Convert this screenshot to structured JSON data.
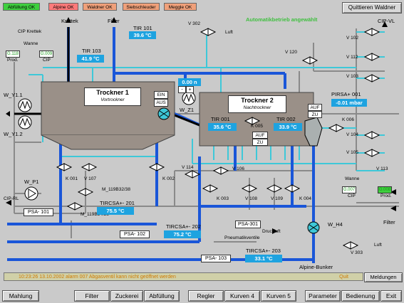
{
  "status_badges": {
    "abfuellung_ok": "Abfüllung OK",
    "alpine_ok": "Alpine OK",
    "waldner_ok": "Waldner OK",
    "siebschleuder": "Siebschleuder",
    "meggle_ok": "Meggle OK"
  },
  "quit_button": "Quittieren Waldner",
  "auto_mode": "Automatikbetrieb angewählt",
  "labels": {
    "krettek": "Krettek",
    "filter_top": "Filter",
    "cip_krettek": "CIP Krettek",
    "wanne_left": "Wanne",
    "g118": "G.118",
    "g009": "G.009",
    "prod_left": "Prod.",
    "cip_left": "CIP",
    "tir101": "TIR 101",
    "tir103": "TIR 103",
    "v302": "V 302",
    "luft_top": "Luft",
    "cip_vl": "CIP-VL",
    "v102": "V 102",
    "v112": "V 112",
    "v103": "V 103",
    "v120": "V 120",
    "wy11": "W_Y1.1",
    "wy12": "W_Y1.2",
    "wz1": "W_Z1",
    "pirsa001": "PIRSA+ 001",
    "k006": "K 006",
    "v104": "V 104",
    "v105": "V 105",
    "v113": "V 113",
    "k001": "K 001",
    "v107": "V 107",
    "k002": "K 002",
    "m119b32": "M_119B32/38",
    "m119b24": "M_119B24/28",
    "v114": "V 114",
    "v106": "V 106",
    "k003": "K 003",
    "v108": "V 108",
    "v109": "V 109",
    "k004": "K 004",
    "wp1": "W_P1",
    "cip_rl": "CIP-RL",
    "psa101": "PSA- 101",
    "psa102": "PSA- 102",
    "psa103": "PSA- 103",
    "psa301": "PSA-301",
    "druckluft": "Druckluft",
    "pneumatikventile": "Pneumatikventile",
    "tircsa201": "TIRCSA+- 201",
    "tircsa202": "TIRCSA+- 202",
    "tircsa203": "TIRCSA+- 203",
    "wanne_right": "Wanne",
    "g007": "G.007",
    "g008": "G.008",
    "cip_right": "CIP",
    "prod_right": "Prod.",
    "filter_right": "Filter",
    "wh4": "W_H4",
    "luft_right": "Luft",
    "v303": "V 303",
    "alpine_bunker": "Alpine-Bunker",
    "k005": "K 005",
    "tir001": "TIR  001",
    "tir002": "TIR  002"
  },
  "values": {
    "tir101": "39.6  °C",
    "tir103": "41.9  °C",
    "zero_n": "0.00   n",
    "tir001": "35.6  °C",
    "tir002": "33.9  °C",
    "pirsa001": "-0.01 mbar",
    "tircsa201": "75.5     °C",
    "tircsa202": "75.2     °C",
    "tircsa203": "33.1     °C"
  },
  "trockner1": {
    "title": "Trockner  1",
    "subtitle": "Vortrockner",
    "ein": "EIN",
    "aus": "AUS"
  },
  "trockner2": {
    "title": "Trockner  2",
    "subtitle": "Nachtrockner",
    "auf": "AUF",
    "zu": "ZU",
    "auf2": "AUF",
    "zu2": "ZU"
  },
  "small_controls": {
    "minus": "-",
    "plus": "+"
  },
  "status_bar": "10:23:26   13.10.2002   alarm 007   Abgasventil kann nicht geöffnet werden",
  "status_bar_right": "Quit",
  "meldungen_button": "Meldungen",
  "bottom_nav": {
    "mahlung": "Mahlung",
    "filter": "Filter",
    "zuckerei": "Zuckerei",
    "abfuellung": "Abfüllung",
    "regler": "Regler",
    "kurven4": "Kurven 4",
    "kurven5": "Kurven 5",
    "parameter": "Parameter",
    "bedienung": "Bedienung",
    "exit": "Exit"
  },
  "colors": {
    "blue_pipe": "#1a56d8",
    "cyan_pipe": "#3ec8d8",
    "value_bg": "#1ea3e0",
    "tank": "#9a9088",
    "grey_pipe": "#8a8a8a"
  }
}
